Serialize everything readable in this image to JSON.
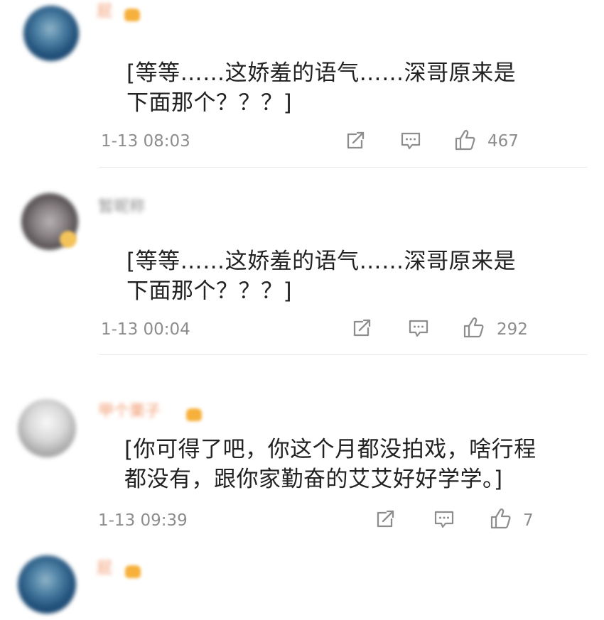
{
  "comments": [
    {
      "username": "屁",
      "username_color": "#f0966b",
      "avatar_style": "blue",
      "text": "[等等……这娇羞的语气……深哥原来是下面那个？？？]",
      "time": "1-13 08:03",
      "likes": "467",
      "share_icon": "share-icon",
      "comment_icon": "comment-icon",
      "like_icon": "like-icon"
    },
    {
      "username": "暂昵称",
      "username_color": "#8f8f8f",
      "avatar_style": "gray",
      "text": "[等等……这娇羞的语气……深哥原来是下面那个？？？]",
      "time": "1-13 00:04",
      "likes": "292",
      "share_icon": "share-icon",
      "comment_icon": "comment-icon",
      "like_icon": "like-icon"
    },
    {
      "username": "甲个栗子",
      "username_color": "#f0966b",
      "avatar_style": "light",
      "text": "[你可得了吧，你这个月都没拍戏，啥行程都没有，跟你家勤奋的艾艾好好学学。]",
      "time": "1-13 09:39",
      "likes": "7",
      "share_icon": "share-icon",
      "comment_icon": "comment-icon",
      "like_icon": "like-icon"
    },
    {
      "username": "屁",
      "username_color": "#f0966b",
      "avatar_style": "blue"
    }
  ]
}
